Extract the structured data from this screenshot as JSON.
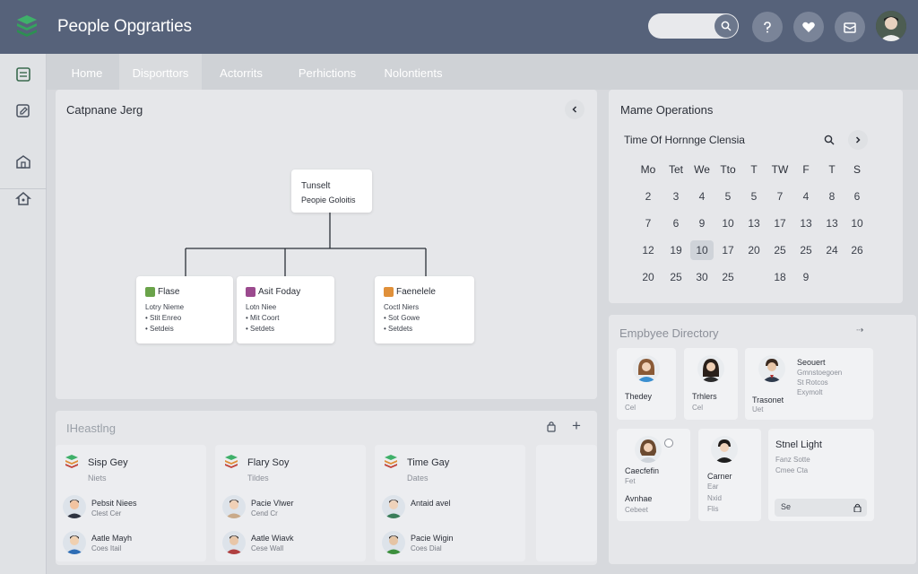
{
  "header": {
    "app_title": "People Opgrarties",
    "colors": {
      "topbar": "#56627a",
      "accent_green": "#3fb06a"
    }
  },
  "tabs": [
    {
      "label": "Home"
    },
    {
      "label": "Disporttors"
    },
    {
      "label": "Actorrits"
    },
    {
      "label": "Perhictions"
    },
    {
      "label": "Nolontients"
    }
  ],
  "org_panel": {
    "title": "Catpnane Jerg",
    "root": {
      "title": "Tunselt",
      "subtitle": "Peopie Goloitis"
    },
    "children": [
      {
        "name": "Flase",
        "line1": "Lotry Nieme",
        "line2": "• Stit Enreo",
        "line3": "• Setdeis",
        "mark_color": "#6aa34a"
      },
      {
        "name": "Asit Foday",
        "line1": "Lotn Niee",
        "line2": "• Mit Coort",
        "line3": "• Setdets",
        "mark_color": "#9b4a8e"
      },
      {
        "name": "Faenelele",
        "line1": "Coctl Niers",
        "line2": "• Sot Gowe",
        "line3": "• Setdets",
        "mark_color": "#e0903a"
      }
    ]
  },
  "calendar_panel": {
    "title": "Mame Operations",
    "subtitle": "Time Of Hornnge Clensia",
    "weekdays": [
      "Mo",
      "Tet",
      "We",
      "Tto",
      "T",
      "TW",
      "F",
      "T",
      "S"
    ],
    "weeks": [
      [
        "2",
        "3",
        "4",
        "5",
        "5",
        "7",
        "4",
        "8",
        "6"
      ],
      [
        "7",
        "6",
        "9",
        "10",
        "13",
        "17",
        "13",
        "13",
        "10"
      ],
      [
        "12",
        "19",
        "10",
        "17",
        "20",
        "25",
        "25",
        "24",
        "26"
      ],
      [
        "20",
        "25",
        "30",
        "25",
        "",
        "18",
        "9",
        "",
        ""
      ]
    ],
    "selected": "10"
  },
  "directory_panel": {
    "title": "Empbyee Directory",
    "employees": [
      {
        "name": "Thedey",
        "sub": "Cel"
      },
      {
        "name": "Trhlers",
        "sub": "Cel"
      },
      {
        "name": "Trasonet",
        "sub": "Uet",
        "extra1": "Seouert",
        "extra2": "Gmnstoegoen",
        "extra3": "St Rotcos",
        "extra4": "Exymolt"
      },
      {
        "name": "Caecfefin",
        "sub": "Fet",
        "sub2": "Avnhae",
        "sub3": "Cebeet"
      },
      {
        "name": "Carner",
        "sub": "Ear",
        "sub2": "Nxid",
        "sub3": "Flis"
      }
    ],
    "side_card": {
      "title": "Stnel Light",
      "line1": "Fanz Sotte",
      "line2": "Cmee Cta",
      "input_value": "Se"
    }
  },
  "meetings_panel": {
    "title": "IHeastlng",
    "cards": [
      {
        "title": "Sisp Gey",
        "sub": "Niets",
        "p1_name": "Pebsit Niees",
        "p1_sub": "Clest Cer",
        "p2_name": "Aatle Mayh",
        "p2_sub": "Coes Itail"
      },
      {
        "title": "Flary Soy",
        "sub": "Tildes",
        "p1_name": "Pacie Vlwer",
        "p1_sub": "Cend Cr",
        "p2_name": "Aatle Wiavk",
        "p2_sub": "Cese Wall"
      },
      {
        "title": "Time Gay",
        "sub": "Dates",
        "p1_name": "Antaid avel",
        "p1_sub": "",
        "p2_name": "Pacie Wigin",
        "p2_sub": "Coes Dial"
      }
    ]
  }
}
